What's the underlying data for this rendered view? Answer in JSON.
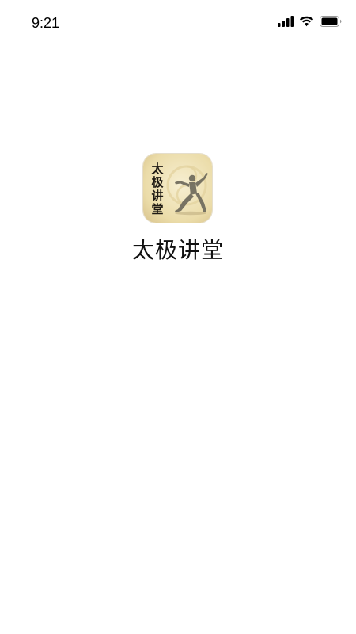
{
  "status_bar": {
    "time": "9:21",
    "icons": [
      "cellular-signal-icon",
      "wifi-icon",
      "battery-icon"
    ]
  },
  "splash": {
    "app_name": "太极讲堂",
    "icon": {
      "name": "tai-chi-figure-logo",
      "calligraphy": "太极讲堂",
      "colors": {
        "background_light": "#F4EAC6",
        "background_dark": "#D9C48E",
        "figure": "#6E6A5C",
        "text": "#1E1A14"
      }
    }
  }
}
